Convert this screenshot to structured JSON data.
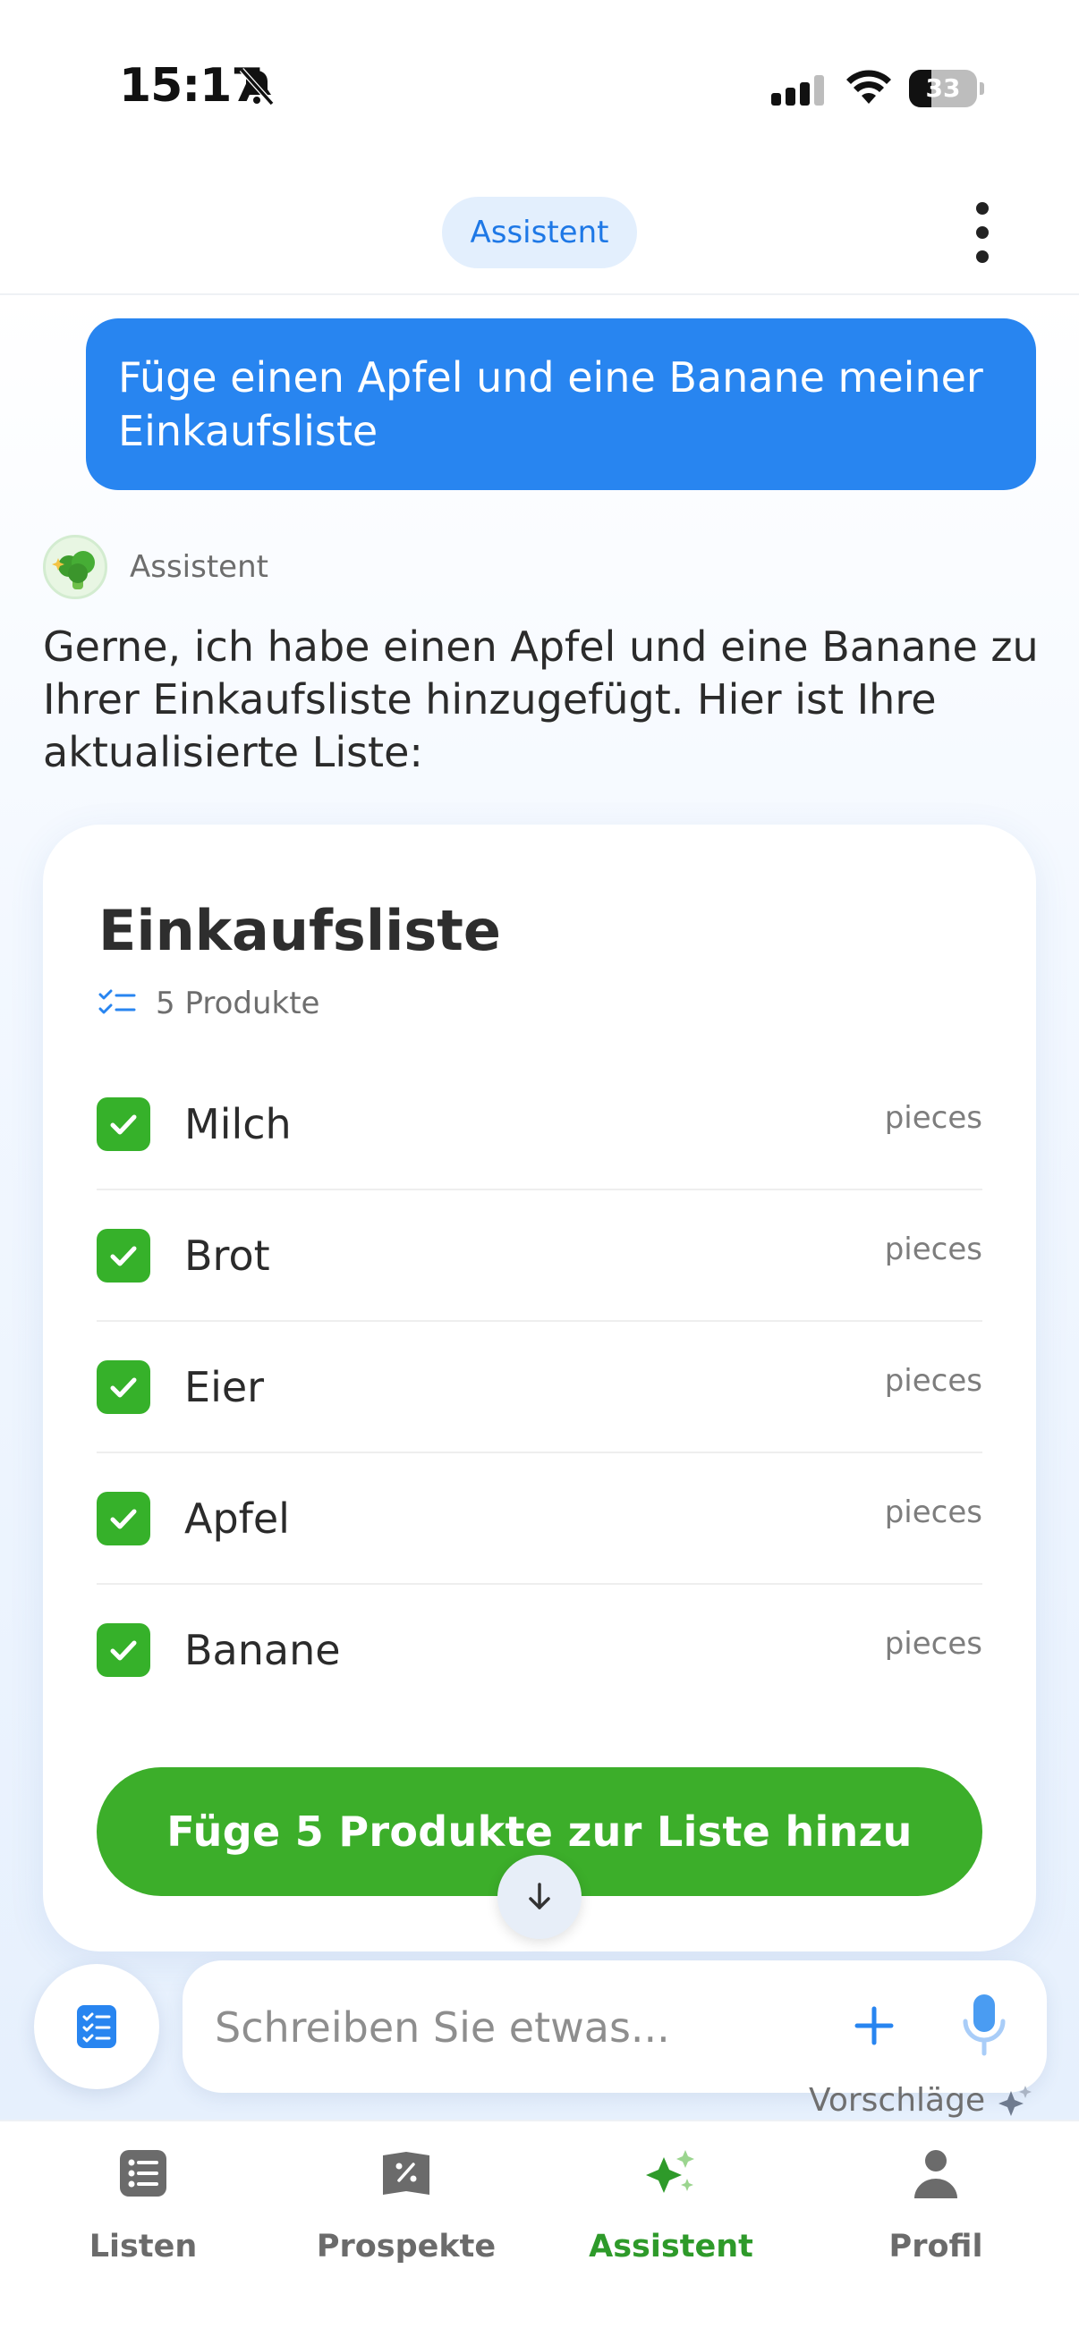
{
  "status_bar": {
    "time": "15:17",
    "battery": 33
  },
  "header": {
    "title": "Assistent"
  },
  "chat": {
    "user_message": "Füge einen Apfel und eine Banane meiner Einkaufsliste",
    "assistant_name": "Assistent",
    "assistant_message": "Gerne, ich habe einen Apfel und eine Banane zu Ihrer Einkaufsliste hinzugefügt. Hier ist Ihre aktualisierte Liste:"
  },
  "card": {
    "title": "Einkaufsliste",
    "count_label": "5 Produkte",
    "items": [
      {
        "name": "Milch",
        "unit": "pieces"
      },
      {
        "name": "Brot",
        "unit": "pieces"
      },
      {
        "name": "Eier",
        "unit": "pieces"
      },
      {
        "name": "Apfel",
        "unit": "pieces"
      },
      {
        "name": "Banane",
        "unit": "pieces"
      }
    ],
    "add_button": "Füge 5 Produkte zur Liste hinzu"
  },
  "composer": {
    "placeholder": "Schreiben Sie etwas...",
    "suggestions": "Vorschläge"
  },
  "tabs": [
    {
      "label": "Listen"
    },
    {
      "label": "Prospekte"
    },
    {
      "label": "Assistent"
    },
    {
      "label": "Profil"
    }
  ],
  "colors": {
    "accent_blue": "#2885f0",
    "accent_green": "#3cae2a",
    "active_tab": "#2e9a2a"
  }
}
